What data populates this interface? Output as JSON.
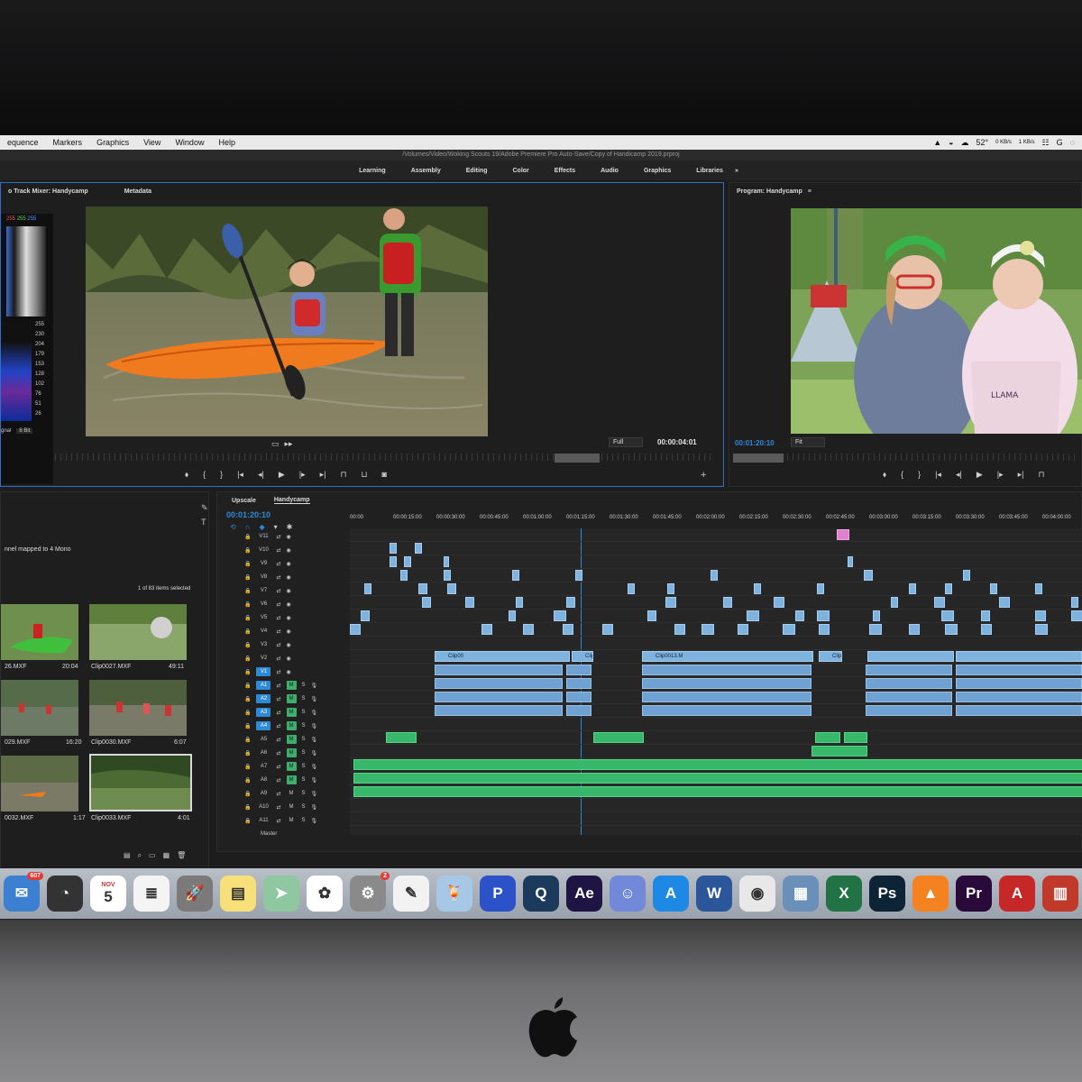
{
  "menubar": {
    "items": [
      "equence",
      "Markers",
      "Graphics",
      "View",
      "Window",
      "Help"
    ],
    "status": {
      "temperature": "52°",
      "net_up": "0 KB/s",
      "net_down": "1 KB/s"
    }
  },
  "path": "/Volumes/Video/Woking Scouts 19/Adobe Premiere Pro Auto-Save/Copy of Handicamp 2019.prproj",
  "workspaces": [
    "Learning",
    "Assembly",
    "Editing",
    "Color",
    "Effects",
    "Audio",
    "Graphics",
    "Libraries"
  ],
  "workspaces_more": "»",
  "source": {
    "tabs": [
      "o Track Mixer: Handycamp",
      "Metadata"
    ],
    "zoom": "Full",
    "timecode": "00:00:04:01",
    "scope_values": [
      "255",
      "230",
      "204",
      "179",
      "153",
      "128",
      "102",
      "76",
      "51",
      "26"
    ],
    "scope_rgb": [
      "255",
      "255",
      "255"
    ],
    "scope_footer": "gnal",
    "bit_depth": "8 Bit"
  },
  "program": {
    "title": "Program: Handycamp",
    "zoom": "Fit",
    "timecode": "00:01:20:10"
  },
  "project": {
    "info": "nnel mapped to 4 Mono",
    "selection": "1 of 83 items selected",
    "clips": [
      {
        "name": "26.MXF",
        "duration": "20:04"
      },
      {
        "name": "Clip0027.MXF",
        "duration": "49:11"
      },
      {
        "name": "029.MXF",
        "duration": "16:20"
      },
      {
        "name": "Clip0030.MXF",
        "duration": "6:07"
      },
      {
        "name": "0032.MXF",
        "duration": "1:17"
      },
      {
        "name": "Clip0033.MXF",
        "duration": "4:01"
      }
    ]
  },
  "timeline": {
    "tabs": [
      "Upscale",
      "Handycamp"
    ],
    "timecode": "00:01:20:10",
    "ruler": [
      "00:00",
      "00:00:15:00",
      "00:00:30:00",
      "00:00:45:00",
      "00:01:00:00",
      "00:01:15:00",
      "00:01:30:00",
      "00:01:45:00",
      "00:02:00:00",
      "00:02:15:00",
      "00:02:30:00",
      "00:02:45:00",
      "00:03:00:00",
      "00:03:15:00",
      "00:03:30:00",
      "00:03:45:00",
      "00:04:00:00"
    ],
    "video_tracks": [
      "V11",
      "V10",
      "V9",
      "V8",
      "V7",
      "V6",
      "V5",
      "V4",
      "V3",
      "V2",
      "V1"
    ],
    "audio_tracks": [
      "A1",
      "A2",
      "A3",
      "A4",
      "A5",
      "A6",
      "A7",
      "A8",
      "A9",
      "A10",
      "A11"
    ],
    "master": "Master",
    "clip_labels": [
      "Clip00",
      "Clip",
      "Clip0013.M",
      "Clip0"
    ]
  },
  "dock": [
    {
      "name": "mail-icon",
      "label": "✉",
      "color": "#3d7fd0",
      "badge": "607"
    },
    {
      "name": "dashboard-icon",
      "label": "◔",
      "color": "#333333"
    },
    {
      "name": "calendar-icon",
      "label": "5",
      "color": "#ffffff",
      "sub": "NOV"
    },
    {
      "name": "reminders-icon",
      "label": "≣",
      "color": "#f4f4f4"
    },
    {
      "name": "launchpad-icon",
      "label": "🚀",
      "color": "#7a7a7a"
    },
    {
      "name": "notes-icon",
      "label": "▤",
      "color": "#f7e07a"
    },
    {
      "name": "maps-icon",
      "label": "➤",
      "color": "#8ec7a0"
    },
    {
      "name": "photos-icon",
      "label": "✿",
      "color": "#ffffff"
    },
    {
      "name": "system-preferences-icon",
      "label": "⚙",
      "color": "#8a8a8a",
      "badge": "2"
    },
    {
      "name": "textedit-icon",
      "label": "✎",
      "color": "#f2f2f2"
    },
    {
      "name": "cocktail-icon",
      "label": "🍹",
      "color": "#a7c7e7"
    },
    {
      "name": "pinstriped-p-icon",
      "label": "P",
      "color": "#2b52c9"
    },
    {
      "name": "quicktime-icon",
      "label": "Q",
      "color": "#1b3a5c"
    },
    {
      "name": "after-effects-icon",
      "label": "Ae",
      "color": "#1f1545"
    },
    {
      "name": "discord-icon",
      "label": "☺",
      "color": "#7289da"
    },
    {
      "name": "app-store-icon",
      "label": "A",
      "color": "#1e88e5"
    },
    {
      "name": "word-icon",
      "label": "W",
      "color": "#2b579a"
    },
    {
      "name": "chrome-icon",
      "label": "◉",
      "color": "#e8e8e8"
    },
    {
      "name": "preview-icon",
      "label": "▦",
      "color": "#6a8fb8"
    },
    {
      "name": "excel-icon",
      "label": "X",
      "color": "#217346"
    },
    {
      "name": "photoshop-icon",
      "label": "Ps",
      "color": "#0d2336"
    },
    {
      "name": "vlc-icon",
      "label": "▲",
      "color": "#f58220"
    },
    {
      "name": "premiere-icon",
      "label": "Pr",
      "color": "#2a0a3b"
    },
    {
      "name": "acrobat-icon",
      "label": "A",
      "color": "#c62828"
    },
    {
      "name": "downloads-folder-icon",
      "label": "▥",
      "color": "#c0392b"
    }
  ]
}
